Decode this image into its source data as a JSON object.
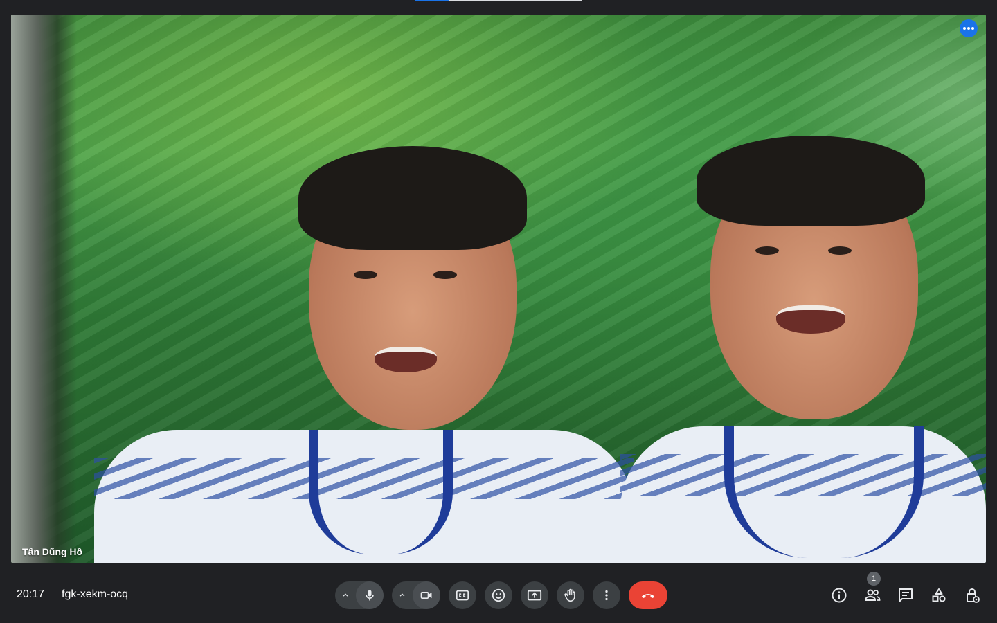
{
  "top_progress": {
    "value": 0.2
  },
  "video": {
    "participant_name": "Tấn Dũng Hồ"
  },
  "meeting": {
    "time": "20:17",
    "code": "fgk-xekm-ocq"
  },
  "controls": {
    "mic_icon": "mic-icon",
    "camera_icon": "videocam-icon",
    "captions_icon": "closed-caption-icon",
    "reactions_icon": "emoji-icon",
    "present_icon": "present-screen-icon",
    "raise_hand_icon": "hand-icon",
    "more_icon": "more-vert-icon",
    "end_call_icon": "call-end-icon",
    "end_call_color": "#ea4335"
  },
  "right_panel": {
    "people_count": "1",
    "icons": [
      "info-icon",
      "people-icon",
      "chat-icon",
      "activities-icon",
      "host-controls-icon"
    ]
  },
  "colors": {
    "background": "#202124",
    "accent": "#1a73e8",
    "button": "#3c4043"
  }
}
